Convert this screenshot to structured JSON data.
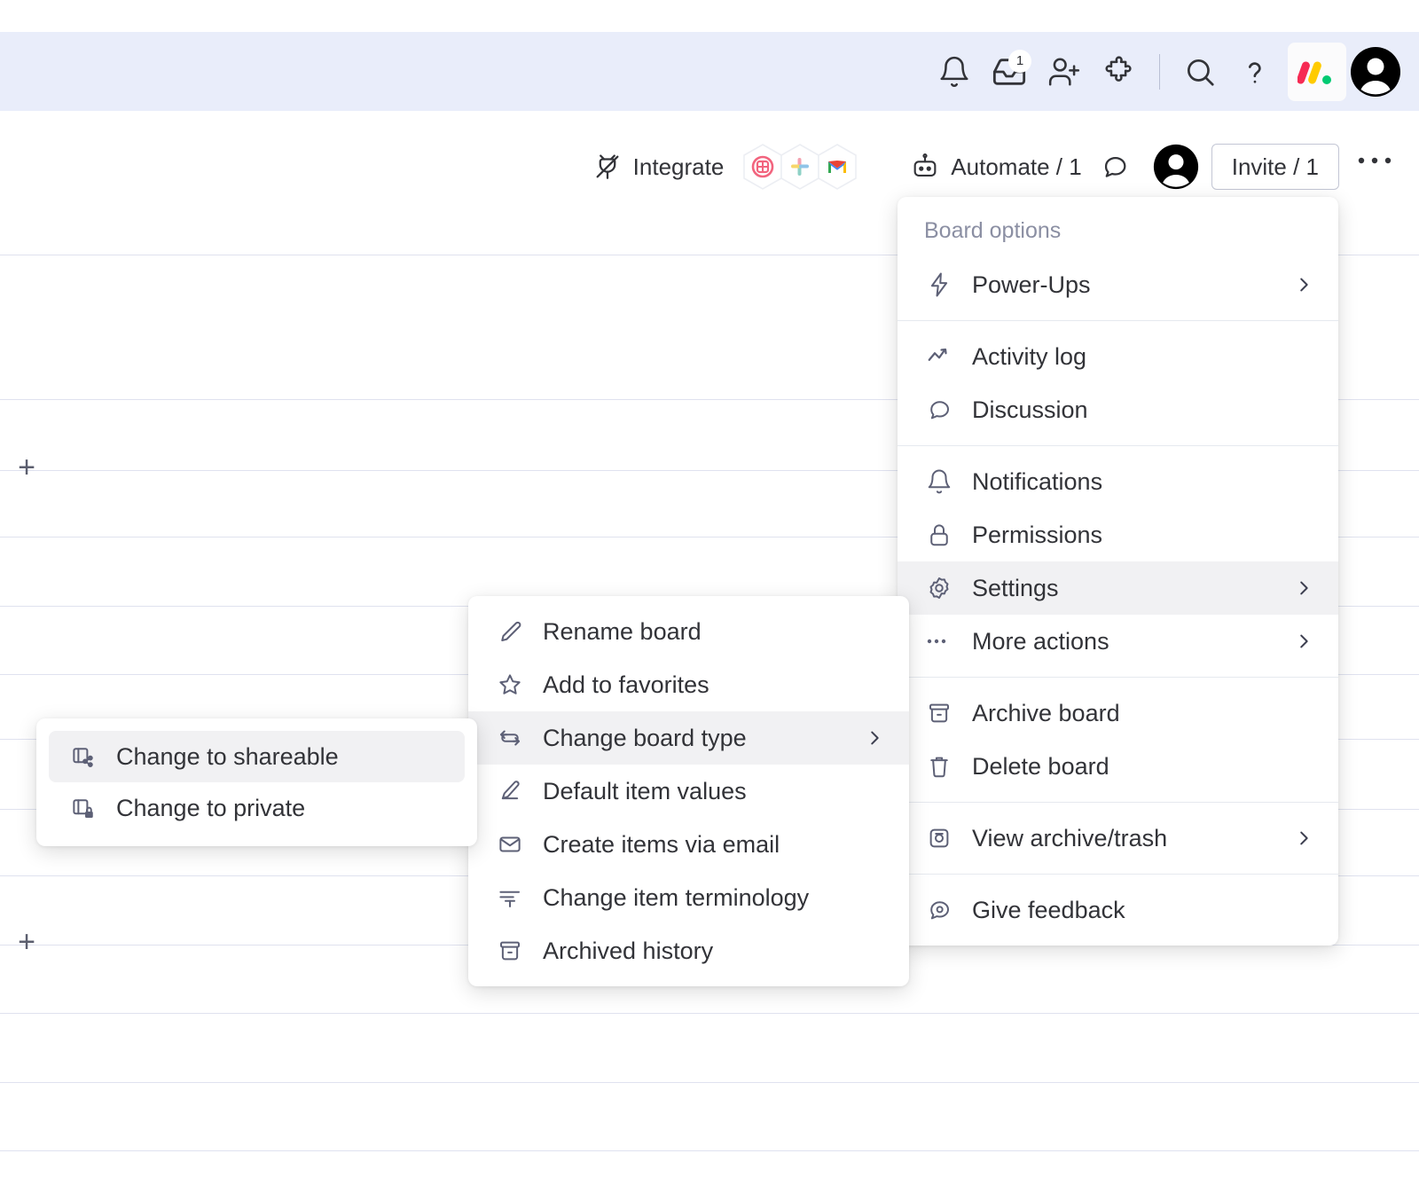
{
  "global_header": {
    "icons": [
      {
        "name": "notifications-bell-icon",
        "label": "Notifications"
      },
      {
        "name": "inbox-icon",
        "label": "Inbox",
        "badge": "1"
      },
      {
        "name": "invite-member-icon",
        "label": "Invite members"
      },
      {
        "name": "apps-puzzle-icon",
        "label": "Apps"
      },
      {
        "name": "search-icon",
        "label": "Search"
      },
      {
        "name": "help-question-icon",
        "label": "Help"
      }
    ],
    "brand_logo": "monday-logo",
    "avatar": "user-avatar"
  },
  "board_toolbar": {
    "integrate_label": "Integrate",
    "integrate_icon": "integrate-plug-icon",
    "integration_apps": [
      "jira-hex-icon",
      "slack-hex-icon",
      "gmail-hex-icon"
    ],
    "automate_label": "Automate / 1",
    "automate_icon": "automate-robot-icon",
    "discussion_icon": "chat-bubble-icon",
    "board_member_avatar": "board-member-avatar",
    "invite_label": "Invite / 1",
    "more_options_icon": "ellipsis-icon"
  },
  "board_canvas": {
    "add_item_label": "+",
    "grid_line_offsets": [
      62,
      225,
      305,
      380,
      458,
      535,
      608,
      687,
      762,
      840,
      917,
      995,
      1072
    ],
    "plus_rows": [
      300,
      833
    ]
  },
  "board_options_menu": {
    "title": "Board options",
    "groups": [
      {
        "items": [
          {
            "icon": "power-ups-bolt-icon",
            "label": "Power-Ups",
            "chevron": true,
            "highlight": false
          }
        ]
      },
      {
        "items": [
          {
            "icon": "activity-log-icon",
            "label": "Activity log",
            "chevron": false,
            "highlight": false
          },
          {
            "icon": "discussion-bubble-icon",
            "label": "Discussion",
            "chevron": false,
            "highlight": false
          }
        ]
      },
      {
        "items": [
          {
            "icon": "notifications-bell-icon",
            "label": "Notifications",
            "chevron": false,
            "highlight": false
          },
          {
            "icon": "permissions-lock-icon",
            "label": "Permissions",
            "chevron": false,
            "highlight": false
          },
          {
            "icon": "settings-gear-icon",
            "label": "Settings",
            "chevron": true,
            "highlight": true
          },
          {
            "icon": "more-actions-ellipsis-icon",
            "label": "More actions",
            "chevron": true,
            "highlight": false
          }
        ]
      },
      {
        "items": [
          {
            "icon": "archive-box-icon",
            "label": "Archive board",
            "chevron": false,
            "highlight": false
          },
          {
            "icon": "trash-can-icon",
            "label": "Delete board",
            "chevron": false,
            "highlight": false
          }
        ]
      },
      {
        "items": [
          {
            "icon": "view-archive-trash-icon",
            "label": "View archive/trash",
            "chevron": true,
            "highlight": false
          }
        ]
      },
      {
        "items": [
          {
            "icon": "give-feedback-icon",
            "label": "Give feedback",
            "chevron": false,
            "highlight": false
          }
        ]
      }
    ]
  },
  "settings_submenu": {
    "items": [
      {
        "icon": "rename-pencil-icon",
        "label": "Rename board",
        "chevron": false,
        "highlight": false
      },
      {
        "icon": "favorite-star-icon",
        "label": "Add to favorites",
        "chevron": false,
        "highlight": false
      },
      {
        "icon": "change-board-type-icon",
        "label": "Change board type",
        "chevron": true,
        "highlight": true
      },
      {
        "icon": "default-item-values-icon",
        "label": "Default item values",
        "chevron": false,
        "highlight": false
      },
      {
        "icon": "email-envelope-icon",
        "label": "Create items via email",
        "chevron": false,
        "highlight": false
      },
      {
        "icon": "change-terminology-icon",
        "label": "Change item terminology",
        "chevron": false,
        "highlight": false
      },
      {
        "icon": "archived-history-icon",
        "label": "Archived history",
        "chevron": false,
        "highlight": false
      }
    ]
  },
  "board_type_submenu": {
    "items": [
      {
        "icon": "board-shareable-icon",
        "label": "Change to shareable",
        "chevron": false,
        "highlight": true
      },
      {
        "icon": "board-private-icon",
        "label": "Change to private",
        "chevron": false,
        "highlight": false
      }
    ]
  },
  "colors": {
    "header_background": "#e9edfa",
    "grid_line": "#dfe2ef",
    "menu_highlight": "#f1f1f3",
    "text_primary": "#323338",
    "text_muted": "#8b8fa3",
    "icon_muted": "#5d6076",
    "logo_red": "#f62b54",
    "logo_yellow": "#ffcb00",
    "logo_green": "#00ca72"
  }
}
